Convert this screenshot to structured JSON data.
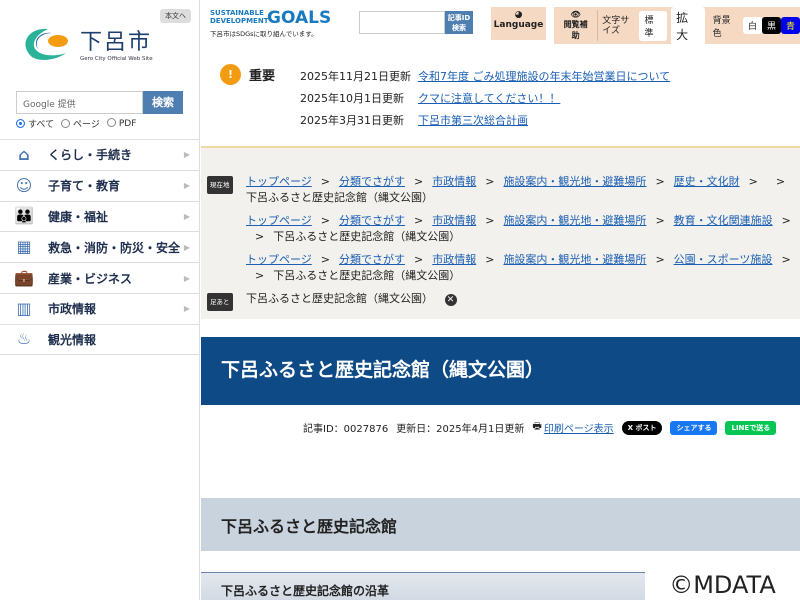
{
  "sidebar": {
    "skip": "本文へ",
    "logo_name": "下呂市",
    "logo_sub": "Gero City Official Web Site",
    "search": {
      "placeholder": "Google 提供",
      "button": "検索"
    },
    "radios": [
      "すべて",
      "ページ",
      "PDF"
    ],
    "nav": [
      {
        "label": "くらし・手続き",
        "icon": "house-icon",
        "glyph": "⌂"
      },
      {
        "label": "子育て・教育",
        "icon": "child-reading-icon",
        "glyph": "☺"
      },
      {
        "label": "健康・福祉",
        "icon": "people-icon",
        "glyph": "👪"
      },
      {
        "label": "救急・消防・防災・安全",
        "icon": "radio-icon",
        "glyph": "▦"
      },
      {
        "label": "産業・ビジネス",
        "icon": "briefcase-icon",
        "glyph": "💼"
      },
      {
        "label": "市政情報",
        "icon": "building-icon",
        "glyph": "▥"
      },
      {
        "label": "観光情報",
        "icon": "hot-spring-icon",
        "glyph": "♨"
      }
    ]
  },
  "header": {
    "sdg_line1": "SUSTAINABLE",
    "sdg_line2": "DEVELOPMENT",
    "sdg_goals": "GOALS",
    "sdg_caption": "下呂市はSDGsに取り組んでいます。",
    "article_search": "記事ID 検索",
    "language": "Language",
    "reading_aid": "閲覧補助",
    "text_size": "文字サイズ",
    "size_normal": "標準",
    "size_large": "拡大",
    "bg_color": "背景色",
    "bg_white": "白",
    "bg_black": "黒",
    "bg_blue": "青"
  },
  "important": {
    "label": "重要",
    "items": [
      {
        "date": "2025年11月21日更新",
        "title": "令和7年度 ごみ処理施設の年末年始営業日について"
      },
      {
        "date": "2025年10月1日更新",
        "title": "クマに注意してください！！"
      },
      {
        "date": "2025年3月31日更新",
        "title": "下呂市第三次総合計画"
      }
    ]
  },
  "breadcrumb": {
    "current_tag": "現在地",
    "trail_tag": "足あと",
    "sep": ">",
    "rows": [
      [
        "トップページ",
        "分類でさがす",
        "市政情報",
        "施設案内・観光地・避難場所",
        "歴史・文化財"
      ],
      [
        "トップページ",
        "分類でさがす",
        "市政情報",
        "施設案内・観光地・避難場所",
        "教育・文化関連施設"
      ],
      [
        "トップページ",
        "分類でさがす",
        "市政情報",
        "施設案内・観光地・避難場所",
        "公園・スポーツ施設"
      ]
    ],
    "current": "下呂ふるさと歴史記念館（縄文公園）",
    "trail": "下呂ふるさと歴史記念館（縄文公園）"
  },
  "page": {
    "title": "下呂ふるさと歴史記念館（縄文公園）",
    "article_id": "記事ID：0027876",
    "updated": "更新日：2025年4月1日更新",
    "print": "印刷ページ表示",
    "share_x": "X ポスト",
    "share_fb": "シェアする",
    "share_line": "LINEで送る",
    "h2": "下呂ふるさと歴史記念館",
    "h3": "下呂ふるさと歴史記念館の沿革"
  },
  "watermark": "©MDATA"
}
